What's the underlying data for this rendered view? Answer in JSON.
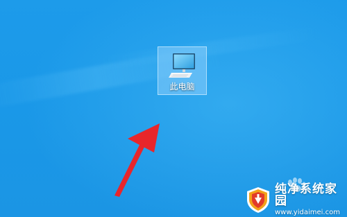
{
  "desktop": {
    "background_color": "#1b98e6",
    "icons": [
      {
        "label": "此电脑",
        "icon": "this-pc-icon",
        "selected": true
      }
    ]
  },
  "annotation": {
    "arrow_color": "#e8262b",
    "icon": "red-arrow-icon"
  },
  "watermark": {
    "title": "纯净系统家园",
    "url": "www.yidaimei.com",
    "logo_icon": "shield-logo-icon"
  }
}
